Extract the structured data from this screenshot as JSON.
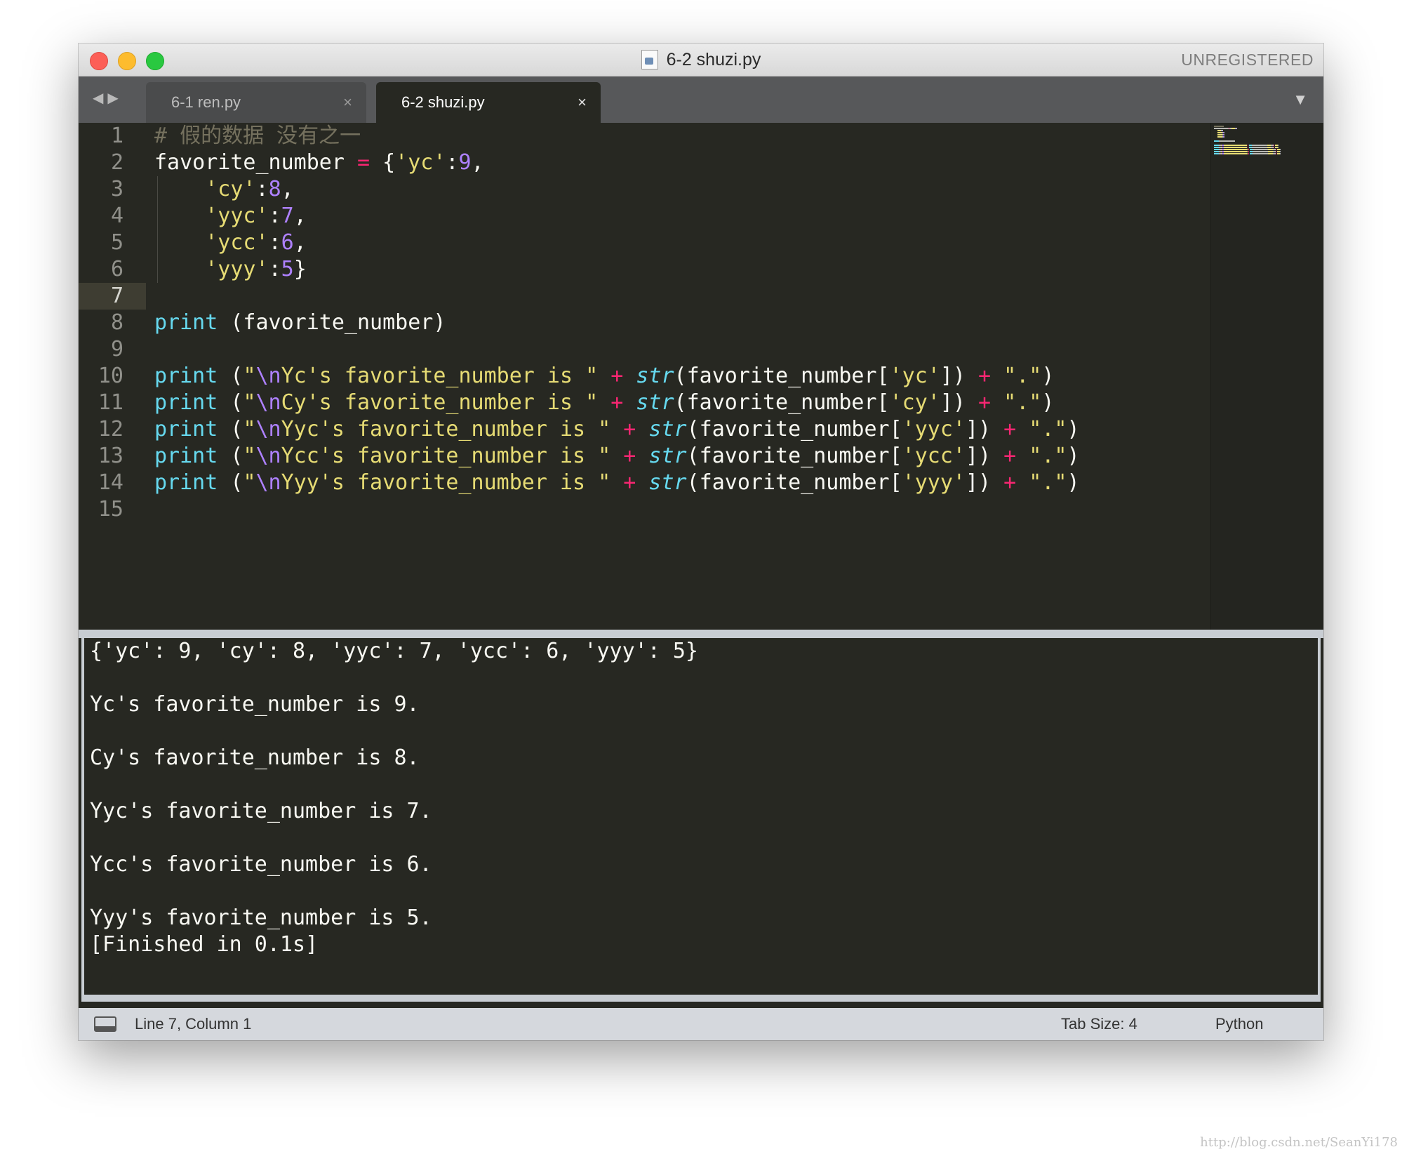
{
  "window": {
    "title": "6-2 shuzi.py",
    "license_label": "UNREGISTERED"
  },
  "tabs": [
    {
      "label": "6-1 ren.py",
      "active": false,
      "close_glyph": "×"
    },
    {
      "label": "6-2 shuzi.py",
      "active": true,
      "close_glyph": "×"
    }
  ],
  "nav": {
    "back": "◀",
    "forward": "▶",
    "tab_menu": "▼"
  },
  "editor": {
    "current_line": 7,
    "line_numbers": [
      "1",
      "2",
      "3",
      "4",
      "5",
      "6",
      "7",
      "8",
      "9",
      "10",
      "11",
      "12",
      "13",
      "14",
      "15"
    ],
    "lines": [
      [
        {
          "t": "# 假的数据 没有之一",
          "c": "cmt"
        }
      ],
      [
        {
          "t": "favorite_number ",
          "c": "plain"
        },
        {
          "t": "=",
          "c": "kw"
        },
        {
          "t": " {",
          "c": "plain"
        },
        {
          "t": "'yc'",
          "c": "str"
        },
        {
          "t": ":",
          "c": "plain"
        },
        {
          "t": "9",
          "c": "num"
        },
        {
          "t": ",",
          "c": "plain"
        }
      ],
      [
        {
          "t": "    ",
          "c": "plain"
        },
        {
          "t": "'cy'",
          "c": "str"
        },
        {
          "t": ":",
          "c": "plain"
        },
        {
          "t": "8",
          "c": "num"
        },
        {
          "t": ",",
          "c": "plain"
        }
      ],
      [
        {
          "t": "    ",
          "c": "plain"
        },
        {
          "t": "'yyc'",
          "c": "str"
        },
        {
          "t": ":",
          "c": "plain"
        },
        {
          "t": "7",
          "c": "num"
        },
        {
          "t": ",",
          "c": "plain"
        }
      ],
      [
        {
          "t": "    ",
          "c": "plain"
        },
        {
          "t": "'ycc'",
          "c": "str"
        },
        {
          "t": ":",
          "c": "plain"
        },
        {
          "t": "6",
          "c": "num"
        },
        {
          "t": ",",
          "c": "plain"
        }
      ],
      [
        {
          "t": "    ",
          "c": "plain"
        },
        {
          "t": "'yyy'",
          "c": "str"
        },
        {
          "t": ":",
          "c": "plain"
        },
        {
          "t": "5",
          "c": "num"
        },
        {
          "t": "}",
          "c": "plain"
        }
      ],
      [],
      [
        {
          "t": "print",
          "c": "fn"
        },
        {
          "t": " (favorite_number)",
          "c": "plain"
        }
      ],
      [],
      [
        {
          "t": "print",
          "c": "fn"
        },
        {
          "t": " (",
          "c": "plain"
        },
        {
          "t": "\"",
          "c": "str"
        },
        {
          "t": "\\n",
          "c": "esc"
        },
        {
          "t": "Yc's favorite_number is \"",
          "c": "str"
        },
        {
          "t": " ",
          "c": "plain"
        },
        {
          "t": "+",
          "c": "kw"
        },
        {
          "t": " ",
          "c": "plain"
        },
        {
          "t": "str",
          "c": "builtin"
        },
        {
          "t": "(favorite_number[",
          "c": "plain"
        },
        {
          "t": "'yc'",
          "c": "str"
        },
        {
          "t": "]) ",
          "c": "plain"
        },
        {
          "t": "+",
          "c": "kw"
        },
        {
          "t": " ",
          "c": "plain"
        },
        {
          "t": "\".\"",
          "c": "str"
        },
        {
          "t": ")",
          "c": "plain"
        }
      ],
      [
        {
          "t": "print",
          "c": "fn"
        },
        {
          "t": " (",
          "c": "plain"
        },
        {
          "t": "\"",
          "c": "str"
        },
        {
          "t": "\\n",
          "c": "esc"
        },
        {
          "t": "Cy's favorite_number is \"",
          "c": "str"
        },
        {
          "t": " ",
          "c": "plain"
        },
        {
          "t": "+",
          "c": "kw"
        },
        {
          "t": " ",
          "c": "plain"
        },
        {
          "t": "str",
          "c": "builtin"
        },
        {
          "t": "(favorite_number[",
          "c": "plain"
        },
        {
          "t": "'cy'",
          "c": "str"
        },
        {
          "t": "]) ",
          "c": "plain"
        },
        {
          "t": "+",
          "c": "kw"
        },
        {
          "t": " ",
          "c": "plain"
        },
        {
          "t": "\".\"",
          "c": "str"
        },
        {
          "t": ")",
          "c": "plain"
        }
      ],
      [
        {
          "t": "print",
          "c": "fn"
        },
        {
          "t": " (",
          "c": "plain"
        },
        {
          "t": "\"",
          "c": "str"
        },
        {
          "t": "\\n",
          "c": "esc"
        },
        {
          "t": "Yyc's favorite_number is \"",
          "c": "str"
        },
        {
          "t": " ",
          "c": "plain"
        },
        {
          "t": "+",
          "c": "kw"
        },
        {
          "t": " ",
          "c": "plain"
        },
        {
          "t": "str",
          "c": "builtin"
        },
        {
          "t": "(favorite_number[",
          "c": "plain"
        },
        {
          "t": "'yyc'",
          "c": "str"
        },
        {
          "t": "]) ",
          "c": "plain"
        },
        {
          "t": "+",
          "c": "kw"
        },
        {
          "t": " ",
          "c": "plain"
        },
        {
          "t": "\".\"",
          "c": "str"
        },
        {
          "t": ")",
          "c": "plain"
        }
      ],
      [
        {
          "t": "print",
          "c": "fn"
        },
        {
          "t": " (",
          "c": "plain"
        },
        {
          "t": "\"",
          "c": "str"
        },
        {
          "t": "\\n",
          "c": "esc"
        },
        {
          "t": "Ycc's favorite_number is \"",
          "c": "str"
        },
        {
          "t": " ",
          "c": "plain"
        },
        {
          "t": "+",
          "c": "kw"
        },
        {
          "t": " ",
          "c": "plain"
        },
        {
          "t": "str",
          "c": "builtin"
        },
        {
          "t": "(favorite_number[",
          "c": "plain"
        },
        {
          "t": "'ycc'",
          "c": "str"
        },
        {
          "t": "]) ",
          "c": "plain"
        },
        {
          "t": "+",
          "c": "kw"
        },
        {
          "t": " ",
          "c": "plain"
        },
        {
          "t": "\".\"",
          "c": "str"
        },
        {
          "t": ")",
          "c": "plain"
        }
      ],
      [
        {
          "t": "print",
          "c": "fn"
        },
        {
          "t": " (",
          "c": "plain"
        },
        {
          "t": "\"",
          "c": "str"
        },
        {
          "t": "\\n",
          "c": "esc"
        },
        {
          "t": "Yyy's favorite_number is \"",
          "c": "str"
        },
        {
          "t": " ",
          "c": "plain"
        },
        {
          "t": "+",
          "c": "kw"
        },
        {
          "t": " ",
          "c": "plain"
        },
        {
          "t": "str",
          "c": "builtin"
        },
        {
          "t": "(favorite_number[",
          "c": "plain"
        },
        {
          "t": "'yyy'",
          "c": "str"
        },
        {
          "t": "]) ",
          "c": "plain"
        },
        {
          "t": "+",
          "c": "kw"
        },
        {
          "t": " ",
          "c": "plain"
        },
        {
          "t": "\".\"",
          "c": "str"
        },
        {
          "t": ")",
          "c": "plain"
        }
      ],
      []
    ]
  },
  "output": {
    "lines": [
      "{'yc': 9, 'cy': 8, 'yyc': 7, 'ycc': 6, 'yyy': 5}",
      "",
      "Yc's favorite_number is 9.",
      "",
      "Cy's favorite_number is 8.",
      "",
      "Yyc's favorite_number is 7.",
      "",
      "Ycc's favorite_number is 6.",
      "",
      "Yyy's favorite_number is 5.",
      "[Finished in 0.1s]"
    ]
  },
  "status": {
    "position": "Line 7, Column 1",
    "tab_size": "Tab Size: 4",
    "syntax": "Python"
  },
  "watermark": "http://blog.csdn.net/SeanYi178",
  "colors": {
    "background": "#272822",
    "comment": "#75715e",
    "string": "#e6db74",
    "number": "#ae81ff",
    "keyword": "#f92672",
    "function": "#66d9ef"
  }
}
